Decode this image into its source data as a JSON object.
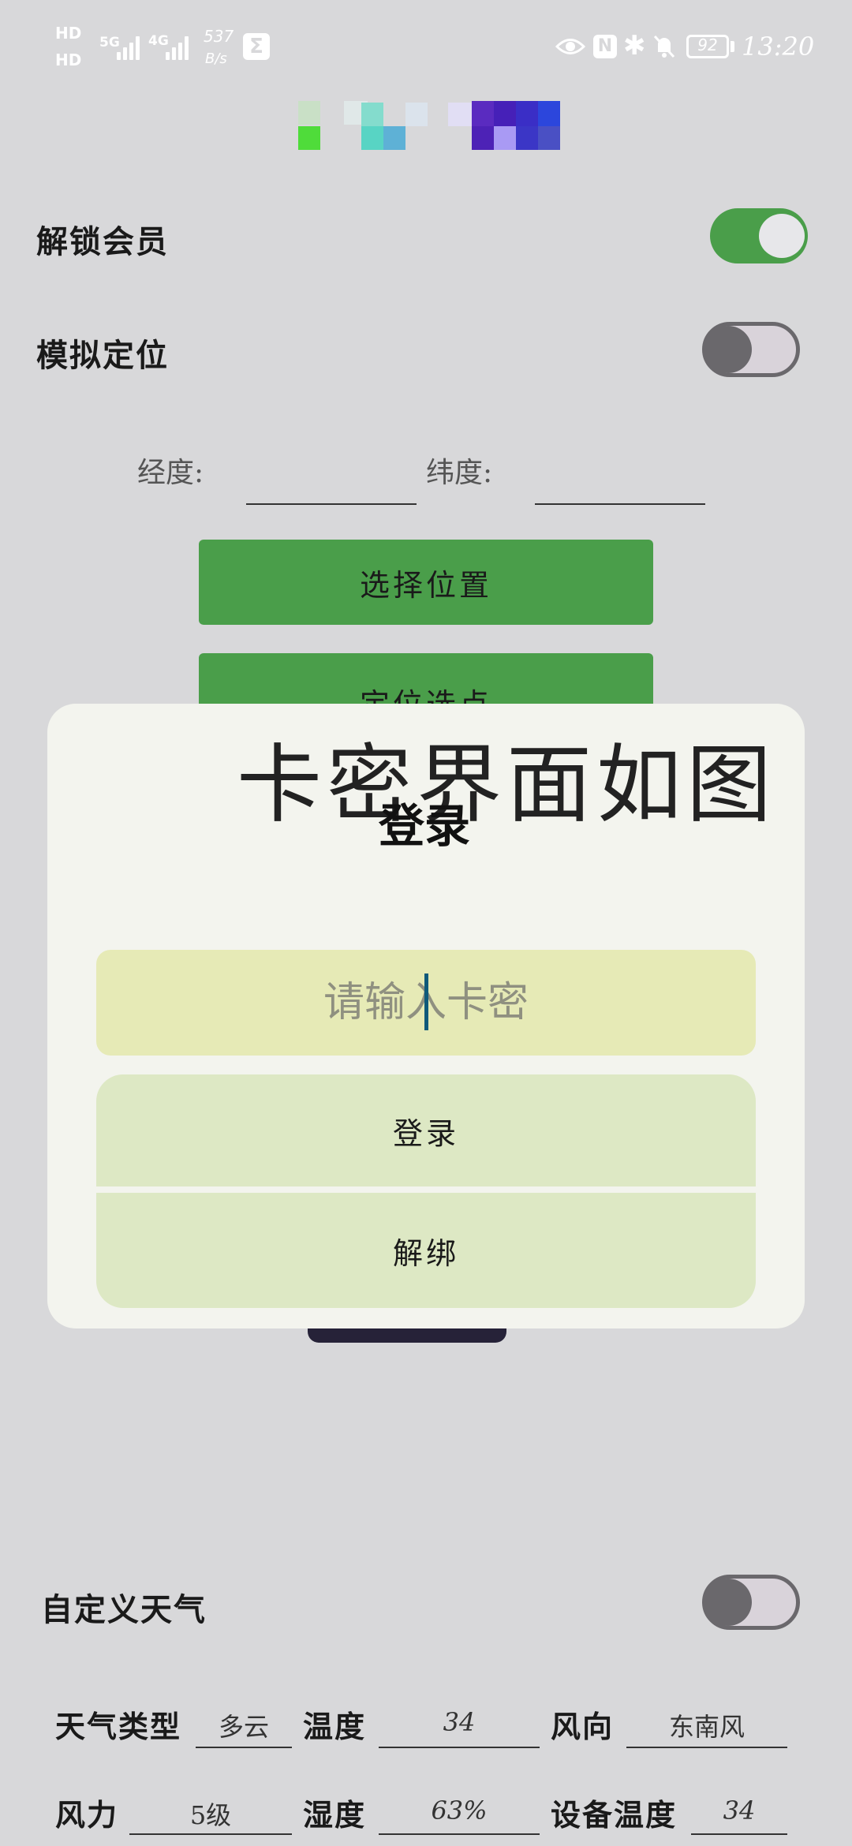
{
  "status_bar": {
    "hd1": "HD",
    "hd2": "HD",
    "net_5g": "5G",
    "net_4g": "4G",
    "speed_value": "537",
    "speed_unit": "B/s",
    "battery": "92",
    "time": "13:20"
  },
  "settings": {
    "unlock_vip": {
      "label": "解锁会员",
      "on": true
    },
    "mock_location": {
      "label": "模拟定位",
      "on": false
    },
    "longitude_label": "经度:",
    "latitude_label": "纬度:",
    "select_location_button": "选择位置",
    "locate_pick_button": "定位选点"
  },
  "dialog": {
    "caption": "卡密界面如图",
    "title": "登录",
    "card_input_placeholder": "请输入卡密",
    "login_button": "登录",
    "unbind_button": "解绑"
  },
  "weather": {
    "custom_weather": {
      "label": "自定义天气",
      "on": false
    },
    "type_label": "天气类型",
    "type_value": "多云",
    "temp_label": "温度",
    "temp_value": "34",
    "wind_dir_label": "风向",
    "wind_dir_value": "东南风",
    "wind_force_label": "风力",
    "wind_force_value": "5级",
    "humidity_label": "湿度",
    "humidity_value": "63%",
    "device_temp_label": "设备温度",
    "device_temp_value": "34"
  },
  "colors": {
    "accent_green": "#4a9e4a",
    "background": "#d8d8da",
    "dialog_bg": "#f3f4ee",
    "input_bg": "#e6eab6",
    "button_bg": "#dde8c4"
  }
}
